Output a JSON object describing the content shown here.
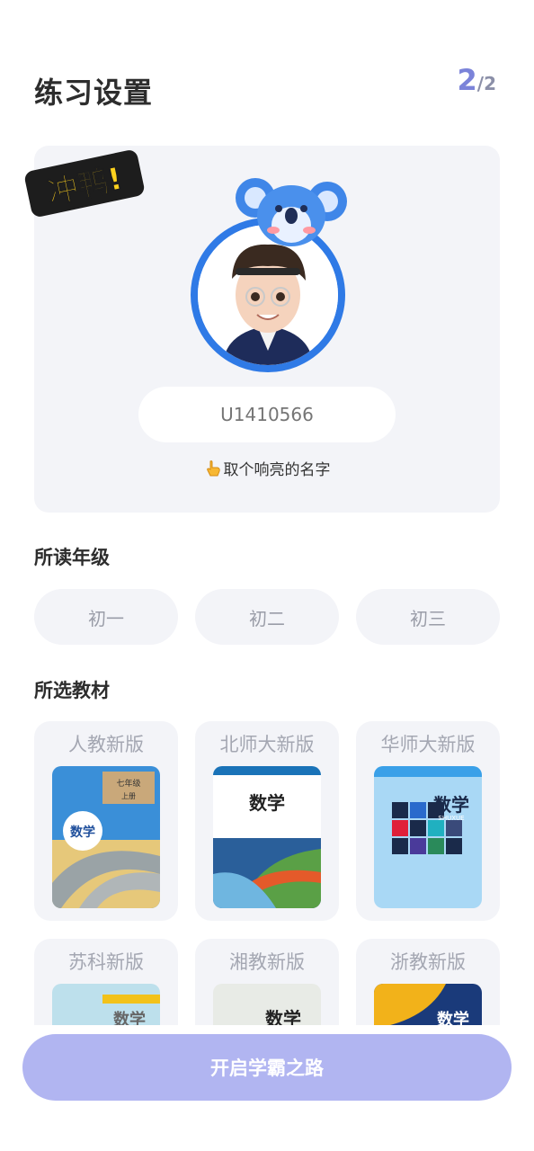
{
  "header": {
    "title": "练习设置",
    "step_current": "2",
    "step_total": "/2"
  },
  "profile": {
    "badge_text": "冲鸭!",
    "username_placeholder": "U1410566",
    "hint": "取个响亮的名字"
  },
  "grade": {
    "label": "所读年级",
    "options": [
      "初一",
      "初二",
      "初三"
    ]
  },
  "textbook": {
    "label": "所选教材",
    "options": [
      {
        "name": "人教新版",
        "cover_title": "数学",
        "cover_grade": "七年级",
        "cover_vol": "上册"
      },
      {
        "name": "北师大新版",
        "cover_title": "数学"
      },
      {
        "name": "华师大新版",
        "cover_title": "数学",
        "cover_sub": "SHUXUE"
      },
      {
        "name": "苏科新版",
        "cover_title": "数学"
      },
      {
        "name": "湘教新版",
        "cover_title": "数学"
      },
      {
        "name": "浙教新版",
        "cover_title": "数学"
      }
    ]
  },
  "start_button": "开启学霸之路",
  "colors": {
    "accent": "#7b83d9",
    "button": "#b1b5f1",
    "ring": "#2f7ae6",
    "card_bg": "#f3f4f8"
  }
}
